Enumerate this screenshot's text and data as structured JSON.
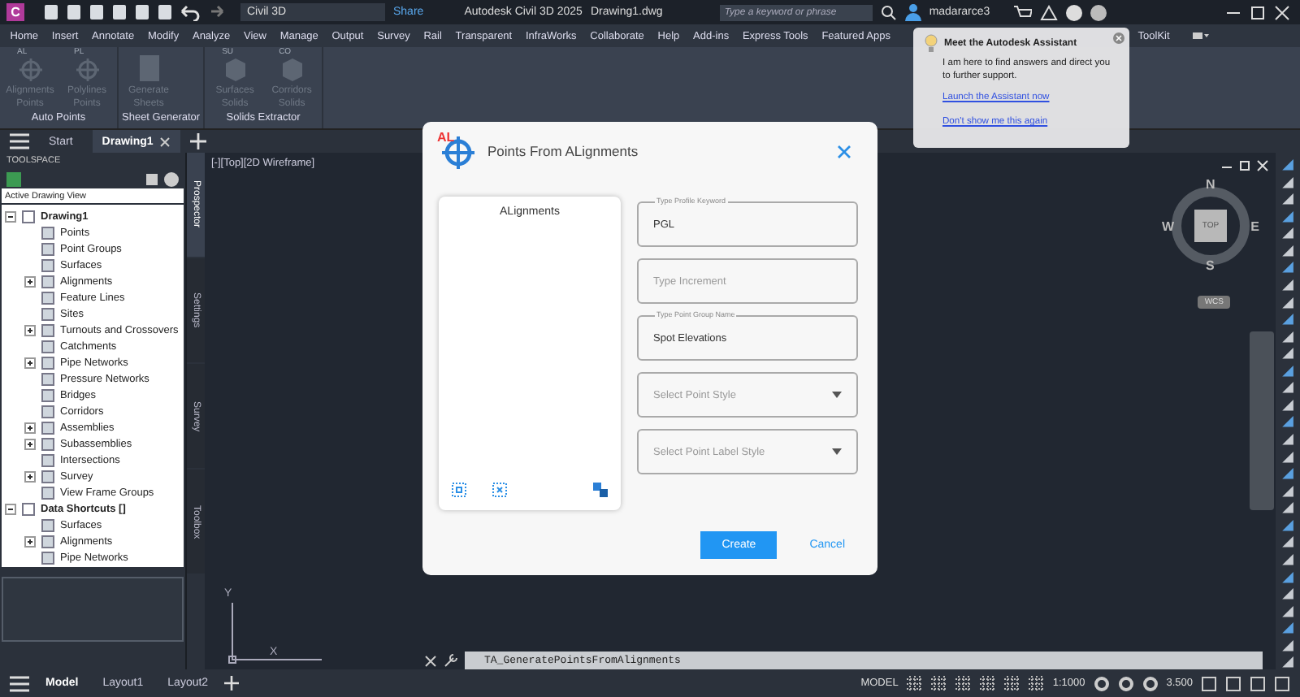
{
  "app": {
    "logo": "C",
    "workspace": "Civil 3D",
    "share": "Share",
    "title": "Autodesk Civil 3D 2025",
    "file": "Drawing1.dwg",
    "search_placeholder": "Type a keyword or phrase",
    "user": "madararce3"
  },
  "menu": [
    "Home",
    "Insert",
    "Annotate",
    "Modify",
    "Analyze",
    "View",
    "Manage",
    "Output",
    "Survey",
    "Rail",
    "Transparent",
    "InfraWorks",
    "Collaborate",
    "Help",
    "Add-ins",
    "Express Tools",
    "Featured Apps"
  ],
  "menu_tail": "ToolKit",
  "ribbon": [
    {
      "title": "Auto Points",
      "buttons": [
        {
          "label": "Alignments Points",
          "badge": "AL",
          "kind": "target",
          "disabled": true
        },
        {
          "label": "Polylines Points",
          "badge": "PL",
          "kind": "target",
          "disabled": true
        }
      ]
    },
    {
      "title": "Sheet Generator",
      "buttons": [
        {
          "label": "Generate Sheets",
          "kind": "sheet",
          "disabled": true
        }
      ]
    },
    {
      "title": "Solids Extractor",
      "buttons": [
        {
          "label": "Surfaces Solids",
          "badge": "SU",
          "kind": "cube",
          "disabled": true
        },
        {
          "label": "Corridors Solids",
          "badge": "CO",
          "kind": "cube",
          "disabled": true
        }
      ]
    }
  ],
  "tabs": [
    {
      "label": "Start",
      "selected": false,
      "closable": false
    },
    {
      "label": "Drawing1",
      "selected": true,
      "closable": true
    }
  ],
  "toolspace": {
    "title": "TOOLSPACE",
    "view": "Active Drawing View",
    "tree": [
      {
        "label": "Drawing1",
        "kind": "folder",
        "expanded": true,
        "children": [
          {
            "label": "Points",
            "kind": "leaf"
          },
          {
            "label": "Point Groups",
            "kind": "leaf"
          },
          {
            "label": "Surfaces",
            "kind": "leaf"
          },
          {
            "label": "Alignments",
            "kind": "folder",
            "expanded": false
          },
          {
            "label": "Feature Lines",
            "kind": "leaf"
          },
          {
            "label": "Sites",
            "kind": "leaf"
          },
          {
            "label": "Turnouts and Crossovers",
            "kind": "folder",
            "expanded": false
          },
          {
            "label": "Catchments",
            "kind": "leaf"
          },
          {
            "label": "Pipe Networks",
            "kind": "folder",
            "expanded": false
          },
          {
            "label": "Pressure Networks",
            "kind": "leaf"
          },
          {
            "label": "Bridges",
            "kind": "leaf"
          },
          {
            "label": "Corridors",
            "kind": "leaf"
          },
          {
            "label": "Assemblies",
            "kind": "folder",
            "expanded": false
          },
          {
            "label": "Subassemblies",
            "kind": "folder",
            "expanded": false
          },
          {
            "label": "Intersections",
            "kind": "leaf"
          },
          {
            "label": "Survey",
            "kind": "folder",
            "expanded": false
          },
          {
            "label": "View Frame Groups",
            "kind": "leaf"
          }
        ]
      },
      {
        "label": "Data Shortcuts []",
        "kind": "folder",
        "expanded": true,
        "children": [
          {
            "label": "Surfaces",
            "kind": "leaf"
          },
          {
            "label": "Alignments",
            "kind": "folder",
            "expanded": false
          },
          {
            "label": "Pipe Networks",
            "kind": "leaf"
          }
        ]
      }
    ],
    "side_tabs": [
      {
        "label": "Prospector",
        "selected": true
      },
      {
        "label": "Settings",
        "selected": false
      },
      {
        "label": "Survey",
        "selected": false
      },
      {
        "label": "Toolbox",
        "selected": false
      }
    ]
  },
  "viewport": {
    "label": "[-][Top][2D Wireframe]",
    "compass": {
      "n": "N",
      "s": "S",
      "e": "E",
      "w": "W",
      "face": "TOP",
      "ucs": "WCS"
    },
    "axis_y": "Y",
    "axis_x": "X"
  },
  "dialog": {
    "logo": "AL",
    "title": "Points From ALignments",
    "list_title": "ALignments",
    "fields": [
      {
        "kind": "text",
        "label": "Type Profile Keyword",
        "value": "PGL"
      },
      {
        "kind": "text",
        "placeholder": "Type Increment"
      },
      {
        "kind": "text",
        "label": "Type Point Group Name",
        "value": "Spot Elevations"
      },
      {
        "kind": "select",
        "placeholder": "Select Point Style"
      },
      {
        "kind": "select",
        "placeholder": "Select Point Label Style"
      }
    ],
    "create": "Create",
    "cancel": "Cancel"
  },
  "assistant": {
    "title": "Meet the Autodesk Assistant",
    "text": "I am here to find answers and direct you to further support.",
    "launch": "Launch the Assistant now",
    "dismiss": "Don't show me this again"
  },
  "command": "TA_GeneratePointsFromAlignments",
  "layouts": [
    {
      "label": "Model",
      "selected": true
    },
    {
      "label": "Layout1",
      "selected": false
    },
    {
      "label": "Layout2",
      "selected": false
    }
  ],
  "status": {
    "mode": "MODEL",
    "scale": "1:1000",
    "value": "3.500"
  }
}
